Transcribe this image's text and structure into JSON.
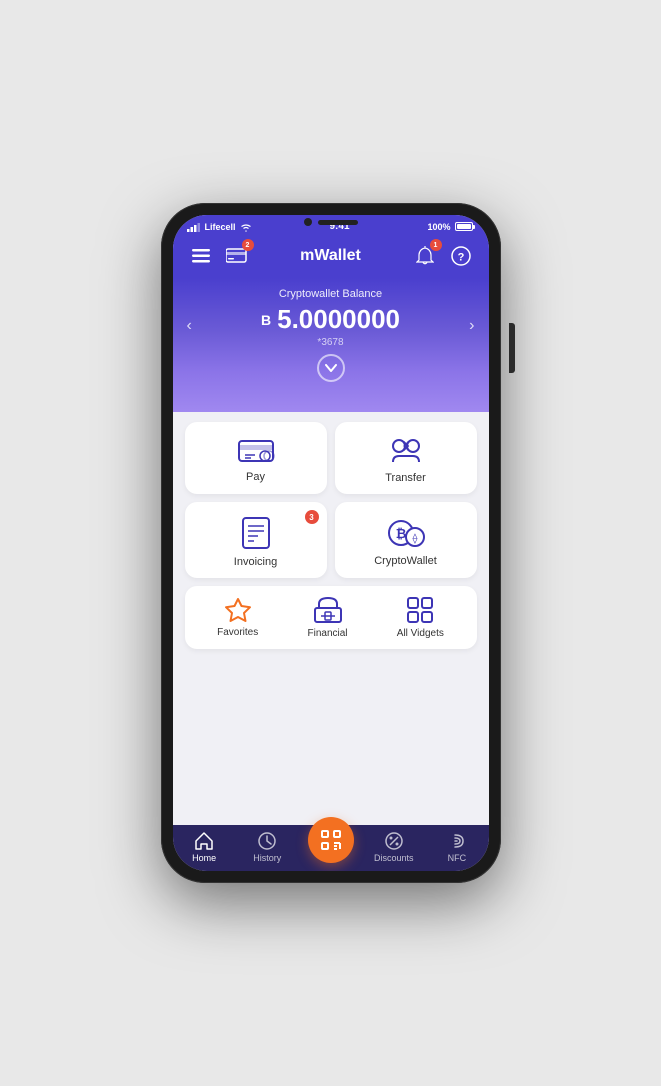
{
  "status": {
    "carrier": "Lifecell",
    "time": "9:41",
    "battery": "100%"
  },
  "header": {
    "title": "mWallet",
    "notification_badge": "1",
    "card_badge": "2"
  },
  "balance": {
    "label": "Cryptowallet Balance",
    "currency_symbol": "B",
    "amount": "5.0000000",
    "account": "*3678",
    "left_arrow": "‹",
    "right_arrow": "›"
  },
  "grid_cards": [
    {
      "id": "pay",
      "label": "Pay",
      "badge": null
    },
    {
      "id": "transfer",
      "label": "Transfer",
      "badge": null
    },
    {
      "id": "invoicing",
      "label": "Invoicing",
      "badge": "3"
    },
    {
      "id": "cryptowallet",
      "label": "CryptoWallet",
      "badge": null
    }
  ],
  "widgets": [
    {
      "id": "favorites",
      "label": "Favorites"
    },
    {
      "id": "financial",
      "label": "Financial"
    },
    {
      "id": "all-vidgets",
      "label": "All Vidgets"
    }
  ],
  "bottom_nav": [
    {
      "id": "home",
      "label": "Home",
      "active": true
    },
    {
      "id": "history",
      "label": "History",
      "active": false
    },
    {
      "id": "scan",
      "label": "",
      "is_scan": true
    },
    {
      "id": "discounts",
      "label": "Discounts",
      "active": false
    },
    {
      "id": "nfc",
      "label": "NFC",
      "active": false
    }
  ]
}
